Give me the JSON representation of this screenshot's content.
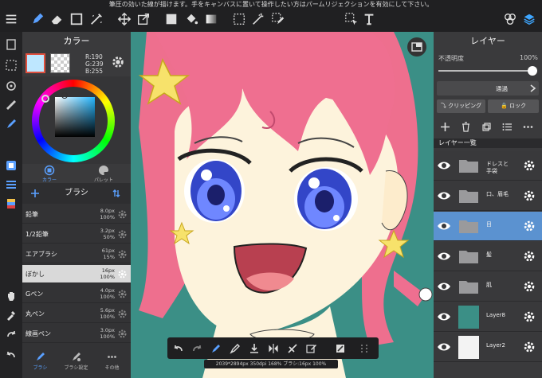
{
  "notice": "筆圧の効いた線が描けます。手をキャンバスに置いて操作したい方はパームリジェクションを有効にして下さい。",
  "colors": {
    "main_color": "#bee7ff",
    "accent": "#e0503f",
    "selected_layer": "#5b92d0",
    "canvas_bg": "#3b8f86"
  },
  "top_toolbar": {
    "icons": [
      "menu-icon",
      "pen-icon",
      "eraser-icon",
      "rectangle-icon",
      "magic-wand-icon",
      "move-icon",
      "transform-icon",
      "fill-color-icon",
      "bucket-icon",
      "gradient-icon",
      "select-rect-icon",
      "select-wand-icon",
      "select-pen-icon",
      "select-move-icon",
      "text-icon",
      "materials-icon",
      "layers-icon"
    ]
  },
  "color_panel": {
    "title": "カラー",
    "r": "R:190",
    "g": "G:239",
    "b": "B:255",
    "tab_color": "カラー",
    "tab_palette": "パレット"
  },
  "brush_panel": {
    "title": "ブラシ",
    "brushes": [
      {
        "name": "鉛筆",
        "size": "8.0px",
        "opacity": "100%"
      },
      {
        "name": "1/2鉛筆",
        "size": "3.2px",
        "opacity": "50%"
      },
      {
        "name": "エアブラシ",
        "size": "61px",
        "opacity": "15%"
      },
      {
        "name": "ぼかし",
        "size": "16px",
        "opacity": "100%"
      },
      {
        "name": "Gペン",
        "size": "4.0px",
        "opacity": "100%"
      },
      {
        "name": "丸ペン",
        "size": "5.6px",
        "opacity": "100%"
      },
      {
        "name": "線画ペン",
        "size": "3.0px",
        "opacity": "100%"
      }
    ],
    "selected_index": 3,
    "tabs": [
      "ブラシ",
      "ブラシ設定",
      "その他"
    ]
  },
  "layer_panel": {
    "title": "レイヤー",
    "opacity_label": "不透明度",
    "opacity_value": "100%",
    "opacity_fraction": 1.0,
    "blend_mode": "通過",
    "clipping": "クリッピング",
    "lock": "ロック",
    "list_title": "レイヤー一覧",
    "layers": [
      {
        "name": "ドレスと\n手袋",
        "kind": "folder"
      },
      {
        "name": "口、眉毛",
        "kind": "folder"
      },
      {
        "name": "目",
        "kind": "folder",
        "selected": true
      },
      {
        "name": "髪",
        "kind": "folder"
      },
      {
        "name": "肌",
        "kind": "folder"
      },
      {
        "name": "Layer8",
        "kind": "image"
      },
      {
        "name": "Layer2",
        "kind": "image"
      }
    ]
  },
  "status": "2039*2894px 350dpi 168% ブラシ:16px 100%"
}
